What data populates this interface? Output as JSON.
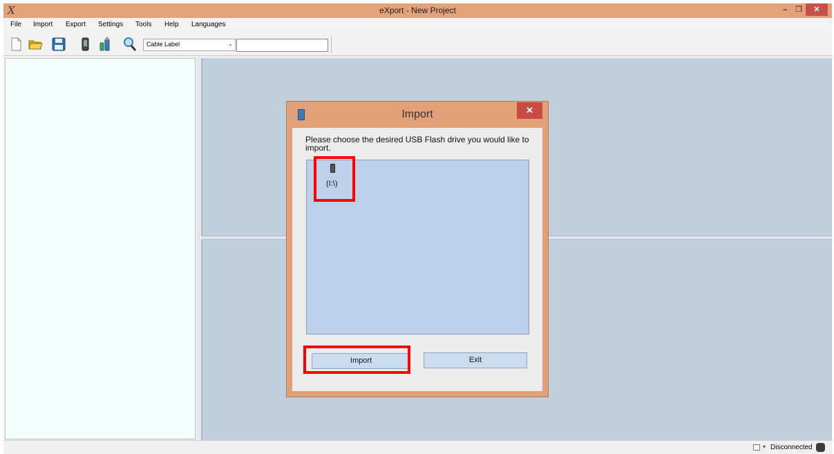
{
  "window": {
    "title": "eXport - New Project",
    "app_icon": "X",
    "minimize_icon": "minimize-icon",
    "maximize_icon": "restore-icon",
    "close_icon": "close-icon",
    "minimize_glyph": "–",
    "restore_glyph": "❐",
    "close_glyph": "✕"
  },
  "menubar": {
    "items": [
      "File",
      "Import",
      "Export",
      "Settings",
      "Tools",
      "Help",
      "Languages"
    ]
  },
  "toolbar": {
    "icons": [
      "new-document-icon",
      "open-folder-icon",
      "save-icon",
      "device-icon",
      "usb-drive-icon",
      "search-icon"
    ],
    "combo_value": "Cable Label",
    "combo_arrow": "⌄",
    "search_value": ""
  },
  "statusbar": {
    "arrow": "▾",
    "connection": "Disconnected"
  },
  "dialog": {
    "title": "Import",
    "close_glyph": "✕",
    "prompt": "Please choose the desired USB Flash drive you would like to import.",
    "drives": [
      {
        "label": "(I:\\)",
        "icon": "usb-drive-icon"
      }
    ],
    "import_button": "Import",
    "exit_button": "Exit"
  },
  "colors": {
    "titlebar": "#e4a27a",
    "close_button": "#c7504a",
    "highlight": "#ff0000",
    "pane": "#c0cfdc",
    "drive_list": "#bcd1e9"
  }
}
